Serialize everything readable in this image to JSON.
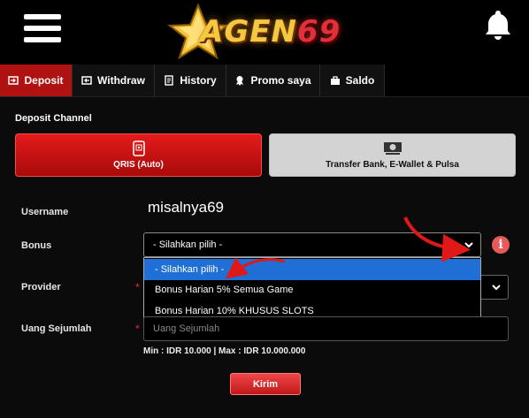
{
  "header": {
    "logo_text_main": "AGEN",
    "logo_text_number": "69"
  },
  "tabs": [
    {
      "label": "Deposit",
      "icon": "deposit-icon"
    },
    {
      "label": "Withdraw",
      "icon": "withdraw-icon"
    },
    {
      "label": "History",
      "icon": "history-icon"
    },
    {
      "label": "Promo saya",
      "icon": "promo-icon"
    },
    {
      "label": "Saldo",
      "icon": "saldo-icon"
    }
  ],
  "deposit_channel": {
    "label": "Deposit Channel",
    "options": [
      {
        "label": "QRIS (Auto)",
        "icon": "qris-phone-icon"
      },
      {
        "label": "Transfer Bank, E-Wallet & Pulsa",
        "icon": "money-icon"
      }
    ]
  },
  "form": {
    "username_label": "Username",
    "username_value": "misalnya69",
    "bonus_label": "Bonus",
    "bonus_selected": "- Silahkan pilih -",
    "bonus_options": [
      "- Silahkan pilih -",
      "Bonus Harian 5% Semua Game",
      "Bonus Harian 10% KHUSUS SLOTS"
    ],
    "provider_label": "Provider",
    "provider_required": "*",
    "amount_label": "Uang Sejumlah",
    "amount_required": "*",
    "amount_placeholder": "Uang Sejumlah",
    "minmax_text": "Min : IDR 10.000  |  Max : IDR 10.000.000",
    "submit_label": "Kirim",
    "info_symbol": "i"
  },
  "colors": {
    "accent_red": "#b01212",
    "highlight_blue": "#1f6fd6",
    "gold": "#f4c840"
  }
}
